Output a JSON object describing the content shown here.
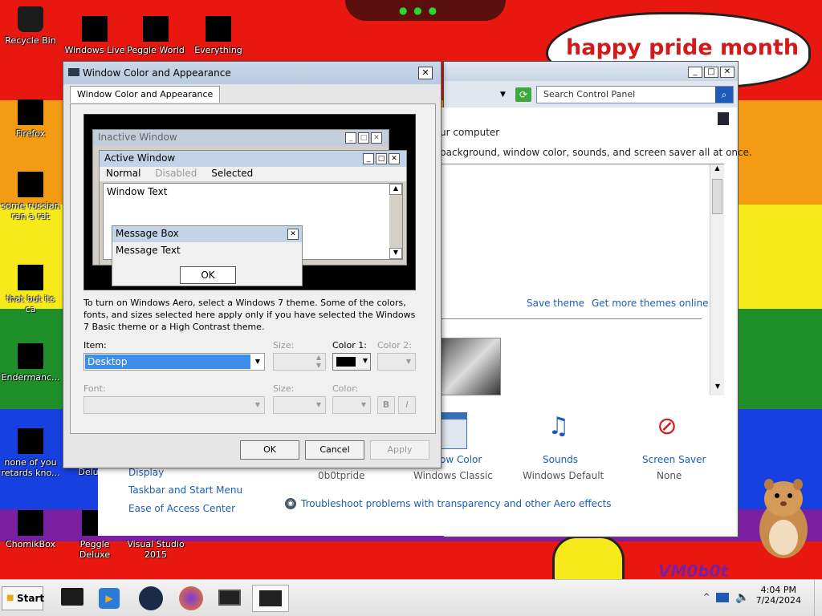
{
  "desktop": {
    "wallpaper_text": "happy pride month",
    "icons": [
      {
        "label": "Recycle Bin",
        "icon": "recycle-bin-icon"
      },
      {
        "label": "Windows Live",
        "icon": "windows-live-icon"
      },
      {
        "label": "Peggle World",
        "icon": "peggle-world-icon"
      },
      {
        "label": "Everything",
        "icon": "everything-icon"
      },
      {
        "label": "Firefox",
        "icon": "firefox-icon"
      },
      {
        "label": "some russian ran a rat",
        "icon": "app-icon"
      },
      {
        "label": "that but its ca",
        "icon": "app-icon"
      },
      {
        "label": "Endermanc...",
        "icon": "app-icon"
      },
      {
        "label": "none of you retards kno...",
        "icon": "app-icon"
      },
      {
        "label": "Delu",
        "icon": "app-icon"
      },
      {
        "label": "ChomikBox",
        "icon": "chomikbox-icon"
      },
      {
        "label": "Peggle Deluxe",
        "icon": "peggle-deluxe-icon"
      },
      {
        "label": "Visual Studio 2015",
        "icon": "visual-studio-icon"
      }
    ]
  },
  "control_panel": {
    "search_placeholder": "Search Control Panel",
    "intro_line1": "ur computer",
    "intro_line2": "background, window color, sounds, and screen saver all at once.",
    "save_theme": "Save theme",
    "get_more_themes": "Get more themes online",
    "bottom_items": [
      {
        "label": "ow Color",
        "sub": "Windows Classic"
      },
      {
        "label": "Sounds",
        "sub": "Windows Default"
      },
      {
        "label": "Screen Saver",
        "sub": "None"
      }
    ],
    "theme_name": "0b0tpride",
    "left_links": [
      "Display",
      "Taskbar and Start Menu",
      "Ease of Access Center"
    ],
    "troubleshoot": "Troubleshoot problems with transparency and other Aero effects"
  },
  "dialog": {
    "title": "Window Color and Appearance",
    "tab": "Window Color and Appearance",
    "preview": {
      "inactive_title": "Inactive Window",
      "active_title": "Active Window",
      "menu_normal": "Normal",
      "menu_disabled": "Disabled",
      "menu_selected": "Selected",
      "window_text": "Window Text",
      "message_title": "Message Box",
      "message_text": "Message Text",
      "ok": "OK"
    },
    "info": "To turn on Windows Aero, select a Windows 7 theme.  Some of the colors, fonts, and sizes selected here apply only if you have selected the Windows 7 Basic theme or a High Contrast theme.",
    "item_label": "Item:",
    "item_value": "Desktop",
    "size_label": "Size:",
    "color1_label": "Color 1:",
    "color2_label": "Color 2:",
    "font_label": "Font:",
    "font_size_label": "Size:",
    "font_color_label": "Color:",
    "bold_label": "B",
    "italic_label": "I",
    "color1_value": "#000000",
    "buttons": {
      "ok": "OK",
      "cancel": "Cancel",
      "apply": "Apply"
    }
  },
  "taskbar": {
    "start": "Start",
    "time": "4:04 PM",
    "date": "7/24/2024"
  }
}
